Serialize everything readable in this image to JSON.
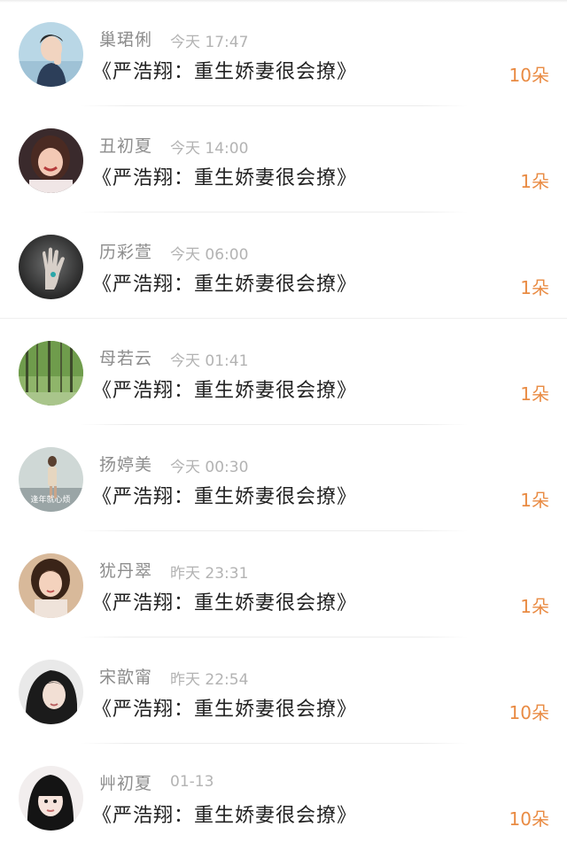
{
  "gifts": [
    {
      "user": "巢珺俐",
      "time": "今天 17:47",
      "book": "《严浩翔：重生娇妻很会撩》",
      "amount": "10朵",
      "avatar_icon": "avatar-boy-blue-background"
    },
    {
      "user": "丑初夏",
      "time": "今天 14:00",
      "book": "《严浩翔：重生娇妻很会撩》",
      "amount": "1朵",
      "avatar_icon": "avatar-smiling-girl"
    },
    {
      "user": "历彩萱",
      "time": "今天 06:00",
      "book": "《严浩翔：重生娇妻很会撩》",
      "amount": "1朵",
      "avatar_icon": "avatar-hand-eye"
    },
    {
      "user": "母若云",
      "time": "今天 01:41",
      "book": "《严浩翔：重生娇妻很会撩》",
      "amount": "1朵",
      "avatar_icon": "avatar-forest"
    },
    {
      "user": "扬婷美",
      "time": "今天 00:30",
      "book": "《严浩翔：重生娇妻很会撩》",
      "amount": "1朵",
      "avatar_icon": "avatar-girl-street",
      "avatar_text": "逢年就心烦"
    },
    {
      "user": "犹丹翠",
      "time": "昨天 23:31",
      "book": "《严浩翔：重生娇妻很会撩》",
      "amount": "1朵",
      "avatar_icon": "avatar-girl-portrait"
    },
    {
      "user": "宋歆甯",
      "time": "昨天 22:54",
      "book": "《严浩翔：重生娇妻很会撩》",
      "amount": "10朵",
      "avatar_icon": "avatar-girl-dark-hair"
    },
    {
      "user": "艸初夏",
      "time": "01-13",
      "book": "《严浩翔：重生娇妻很会撩》",
      "amount": "10朵",
      "avatar_icon": "avatar-girl-bangs"
    }
  ],
  "colors": {
    "name": "#8d8d8d",
    "time": "#b3b3b3",
    "title": "#222222",
    "amount": "#e98b43"
  }
}
